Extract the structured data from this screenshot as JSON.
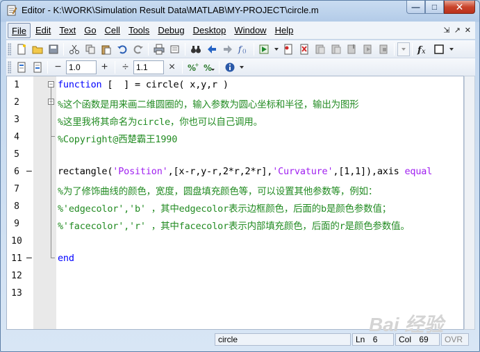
{
  "window": {
    "title": "Editor - K:\\WORK\\Simulation Result Data\\MATLAB\\MY-PROJECT\\circle.m",
    "min_glyph": "—",
    "max_glyph": "□",
    "close_glyph": "✕"
  },
  "menu": {
    "items": [
      "File",
      "Edit",
      "Text",
      "Go",
      "Cell",
      "Tools",
      "Debug",
      "Desktop",
      "Window",
      "Help"
    ],
    "right_glyphs": [
      "⇲",
      "↗",
      "✕"
    ]
  },
  "toolbar2": {
    "minus_glyph": "−",
    "plus_glyph": "+",
    "divide_glyph": "÷",
    "times_glyph": "×",
    "field1_value": "1.0",
    "field2_value": "1.1"
  },
  "editor": {
    "lines": [
      {
        "n": "1",
        "dash": "",
        "segs": [
          {
            "c": "kw",
            "t": "function"
          },
          {
            "c": "plain",
            "t": " [  ] = circle( x,y,r )"
          }
        ]
      },
      {
        "n": "2",
        "dash": "",
        "segs": [
          {
            "c": "cm",
            "t": "%这个函数是用来画二维圆圈的，输入参数为圆心坐标和半径，输出为图形"
          }
        ]
      },
      {
        "n": "3",
        "dash": "",
        "segs": [
          {
            "c": "cm",
            "t": "%这里我将其命名为circle，你也可以自己调用。"
          }
        ]
      },
      {
        "n": "4",
        "dash": "",
        "segs": [
          {
            "c": "cm",
            "t": "%Copyright@西楚霸王1990"
          }
        ]
      },
      {
        "n": "5",
        "dash": "",
        "segs": []
      },
      {
        "n": "6",
        "dash": "—",
        "segs": [
          {
            "c": "plain",
            "t": "rectangle("
          },
          {
            "c": "str",
            "t": "'Position'"
          },
          {
            "c": "plain",
            "t": ",[x-r,y-r,2*r,2*r],"
          },
          {
            "c": "str",
            "t": "'Curvature'"
          },
          {
            "c": "plain",
            "t": ",[1,1]),axis "
          },
          {
            "c": "str",
            "t": "equal"
          }
        ]
      },
      {
        "n": "7",
        "dash": "",
        "segs": [
          {
            "c": "cm",
            "t": "%为了修饰曲线的颜色，宽度，圆盘填充颜色等，可以设置其他参数等，例如："
          }
        ]
      },
      {
        "n": "8",
        "dash": "",
        "segs": [
          {
            "c": "cm",
            "t": "%'edgecolor','b' ，其中edgecolor表示边框颜色，后面的b是颜色参数值；"
          }
        ]
      },
      {
        "n": "9",
        "dash": "",
        "segs": [
          {
            "c": "cm",
            "t": "%'facecolor','r' ，其中facecolor表示内部填充颜色，后面的r是颜色参数值。"
          }
        ]
      },
      {
        "n": "10",
        "dash": "",
        "segs": []
      },
      {
        "n": "11",
        "dash": "—",
        "segs": [
          {
            "c": "kw",
            "t": "end"
          }
        ]
      },
      {
        "n": "12",
        "dash": "",
        "segs": []
      },
      {
        "n": "13",
        "dash": "",
        "segs": []
      }
    ]
  },
  "status": {
    "function_name": "circle",
    "ln_label": "Ln",
    "ln_value": "6",
    "col_label": "Col",
    "col_value": "69",
    "ovr": "OVR"
  },
  "watermark": "Bai 经验",
  "colors": {
    "keyword": "#0000ff",
    "comment": "#228b22",
    "string": "#a020f0"
  }
}
